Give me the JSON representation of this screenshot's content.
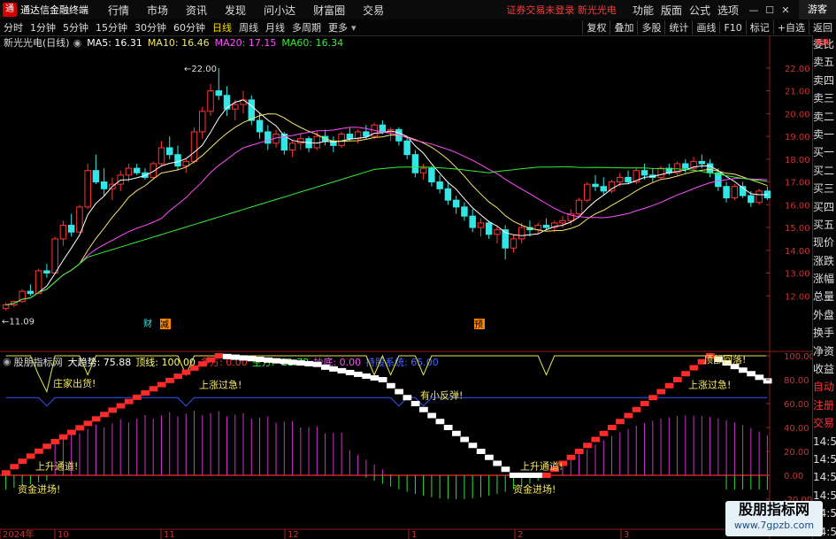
{
  "app": {
    "title": "通达信金融终端",
    "menus": [
      "行情",
      "市场",
      "资讯",
      "发现",
      "问小达",
      "财富圈",
      "交易"
    ],
    "warning": "证券交易未登录 新光光电",
    "right_menus": [
      "功能",
      "版面",
      "公式",
      "选项"
    ],
    "guest": "游客"
  },
  "periods": [
    {
      "label": "分时"
    },
    {
      "label": "1分钟"
    },
    {
      "label": "5分钟"
    },
    {
      "label": "15分钟"
    },
    {
      "label": "30分钟"
    },
    {
      "label": "60分钟"
    },
    {
      "label": "日线",
      "active": true
    },
    {
      "label": "周线"
    },
    {
      "label": "月线"
    },
    {
      "label": "多周期"
    },
    {
      "label": "更多"
    }
  ],
  "tools": [
    "复权",
    "叠加",
    "多股",
    "统计",
    "画线",
    "F10",
    "标记",
    "+自选",
    "返回"
  ],
  "stock": {
    "name": "新光光电(日线)",
    "ma": [
      {
        "label": "MA5: 16.31",
        "color": "#ffffff"
      },
      {
        "label": "MA10: 16.46",
        "color": "#f5e663"
      },
      {
        "label": "MA20: 17.15",
        "color": "#ff4dff"
      },
      {
        "label": "MA60: 16.34",
        "color": "#33ee33"
      }
    ]
  },
  "indicator": {
    "name": "股朋指标网",
    "values": [
      {
        "label": "大趋势: 75.88",
        "color": "#ffffff"
      },
      {
        "label": "顶线: 100.00",
        "color": "#ffff66"
      },
      {
        "label": "多方: 0.00",
        "color": "#ff3333"
      },
      {
        "label": "空方: -21.72",
        "color": "#33ff33"
      },
      {
        "label": "抄底: 0.00",
        "color": "#ff4dff"
      },
      {
        "label": "持股系统: 65.00",
        "color": "#4466ff"
      }
    ]
  },
  "price_axis": [
    "22.00",
    "21.00",
    "20.00",
    "19.00",
    "18.00",
    "17.00",
    "16.00",
    "15.00",
    "14.00",
    "13.00",
    "12.00"
  ],
  "ind_axis": [
    "100.00",
    "80.00",
    "60.00",
    "40.00",
    "20.00",
    "0.00",
    "-20.00"
  ],
  "date_axis": [
    "2024年",
    "10",
    "11",
    "12",
    "1",
    "2",
    "3"
  ],
  "annotations": {
    "high": "22.00",
    "low": "11.09",
    "cai": "财",
    "jian": "减",
    "yu": "预",
    "ind": [
      "庄家出货!",
      "上涨过急!",
      "有小反弹!",
      "上升通道!",
      "资金进场!",
      "上升通道!",
      "资金进场!",
      "上涨过急!",
      "顶部回落!"
    ]
  },
  "sidebar": [
    "委比",
    "卖五",
    "卖四",
    "卖三",
    "卖二",
    "卖一",
    "买一",
    "买二",
    "买三",
    "买四",
    "买五",
    "现价",
    "涨跌",
    "涨幅",
    "总量",
    "外盘",
    "换手",
    "净资",
    "收益",
    "自动",
    "注册",
    "交易",
    "14:54",
    "14:54",
    "14:54",
    "14:55",
    "14:55",
    "14:56",
    "14:56"
  ],
  "watermark": {
    "a": "股朋指标网",
    "b": "www.7gpzb.com"
  },
  "candles": [
    [
      11.45,
      11.7,
      11.35,
      11.6
    ],
    [
      11.6,
      11.8,
      11.5,
      11.75
    ],
    [
      11.75,
      12.3,
      11.7,
      12.2
    ],
    [
      12.2,
      12.5,
      12.0,
      12.1
    ],
    [
      12.1,
      13.2,
      12.1,
      13.1
    ],
    [
      13.1,
      13.4,
      12.8,
      13.0
    ],
    [
      13.0,
      14.6,
      13.0,
      14.5
    ],
    [
      14.5,
      15.3,
      14.2,
      15.1
    ],
    [
      15.1,
      15.6,
      14.6,
      14.8
    ],
    [
      14.8,
      16.0,
      14.8,
      15.9
    ],
    [
      15.9,
      17.8,
      15.8,
      17.5
    ],
    [
      17.5,
      18.2,
      16.9,
      17.0
    ],
    [
      17.0,
      17.6,
      16.4,
      16.7
    ],
    [
      16.7,
      17.2,
      16.2,
      16.9
    ],
    [
      16.9,
      17.5,
      16.6,
      17.3
    ],
    [
      17.3,
      17.8,
      17.0,
      17.6
    ],
    [
      17.6,
      17.8,
      17.3,
      17.4
    ],
    [
      17.4,
      17.6,
      17.1,
      17.2
    ],
    [
      17.2,
      17.9,
      17.1,
      17.8
    ],
    [
      17.8,
      18.8,
      17.7,
      18.5
    ],
    [
      18.5,
      19.0,
      18.0,
      18.2
    ],
    [
      18.2,
      18.6,
      17.5,
      17.7
    ],
    [
      17.7,
      18.0,
      17.4,
      17.9
    ],
    [
      17.9,
      19.4,
      17.8,
      19.2
    ],
    [
      19.2,
      20.3,
      18.9,
      20.1
    ],
    [
      20.1,
      21.3,
      19.9,
      21.0
    ],
    [
      21.0,
      22.0,
      20.6,
      20.8
    ],
    [
      20.8,
      21.2,
      19.9,
      20.2
    ],
    [
      20.2,
      20.6,
      19.7,
      20.4
    ],
    [
      20.4,
      21.0,
      20.0,
      20.6
    ],
    [
      20.6,
      20.8,
      19.5,
      19.7
    ],
    [
      19.7,
      20.0,
      18.9,
      19.2
    ],
    [
      19.2,
      19.5,
      18.4,
      18.7
    ],
    [
      18.7,
      19.3,
      18.5,
      19.1
    ],
    [
      19.1,
      19.2,
      18.2,
      18.4
    ],
    [
      18.4,
      18.8,
      18.1,
      18.7
    ],
    [
      18.7,
      19.1,
      18.4,
      18.9
    ],
    [
      18.9,
      19.0,
      18.3,
      18.5
    ],
    [
      18.5,
      19.2,
      18.4,
      19.0
    ],
    [
      19.0,
      19.3,
      18.6,
      18.8
    ],
    [
      18.8,
      19.0,
      18.3,
      18.6
    ],
    [
      18.6,
      19.2,
      18.5,
      19.1
    ],
    [
      19.1,
      19.4,
      18.8,
      18.9
    ],
    [
      18.9,
      19.3,
      18.7,
      19.2
    ],
    [
      19.2,
      19.5,
      18.9,
      19.0
    ],
    [
      19.0,
      19.6,
      18.9,
      19.5
    ],
    [
      19.5,
      19.7,
      19.1,
      19.2
    ],
    [
      19.2,
      19.4,
      18.8,
      19.3
    ],
    [
      19.3,
      19.4,
      18.6,
      18.8
    ],
    [
      18.8,
      19.0,
      18.0,
      18.2
    ],
    [
      18.2,
      18.4,
      17.2,
      17.4
    ],
    [
      17.4,
      17.8,
      17.1,
      17.6
    ],
    [
      17.6,
      17.7,
      16.8,
      17.0
    ],
    [
      17.0,
      17.3,
      16.5,
      16.7
    ],
    [
      16.7,
      17.0,
      16.0,
      16.2
    ],
    [
      16.2,
      16.4,
      15.6,
      15.9
    ],
    [
      15.9,
      16.1,
      15.3,
      15.5
    ],
    [
      15.5,
      15.8,
      14.8,
      15.0
    ],
    [
      15.0,
      15.4,
      14.6,
      15.2
    ],
    [
      15.2,
      15.3,
      14.5,
      14.7
    ],
    [
      14.7,
      15.1,
      14.3,
      14.9
    ],
    [
      14.9,
      15.1,
      13.6,
      14.1
    ],
    [
      14.1,
      14.7,
      13.9,
      14.5
    ],
    [
      14.5,
      15.2,
      14.3,
      15.0
    ],
    [
      15.0,
      15.3,
      14.6,
      14.9
    ],
    [
      14.9,
      15.2,
      14.7,
      15.1
    ],
    [
      15.1,
      15.4,
      14.9,
      15.0
    ],
    [
      15.0,
      15.3,
      14.8,
      15.2
    ],
    [
      15.2,
      15.5,
      15.0,
      15.3
    ],
    [
      15.3,
      15.8,
      15.1,
      15.6
    ],
    [
      15.6,
      16.3,
      15.5,
      16.2
    ],
    [
      16.2,
      17.0,
      16.1,
      16.9
    ],
    [
      16.9,
      17.3,
      16.6,
      16.8
    ],
    [
      16.8,
      17.2,
      16.4,
      16.6
    ],
    [
      16.6,
      17.1,
      16.5,
      17.0
    ],
    [
      17.0,
      17.4,
      16.8,
      17.2
    ],
    [
      17.2,
      17.5,
      16.9,
      17.0
    ],
    [
      17.0,
      17.6,
      16.9,
      17.5
    ],
    [
      17.5,
      17.8,
      17.1,
      17.3
    ],
    [
      17.3,
      17.6,
      17.0,
      17.2
    ],
    [
      17.2,
      17.7,
      17.1,
      17.6
    ],
    [
      17.6,
      17.8,
      17.3,
      17.4
    ],
    [
      17.4,
      17.9,
      17.3,
      17.8
    ],
    [
      17.8,
      18.0,
      17.4,
      17.6
    ],
    [
      17.6,
      18.1,
      17.5,
      17.9
    ],
    [
      17.9,
      18.2,
      17.6,
      17.8
    ],
    [
      17.8,
      18.0,
      17.2,
      17.4
    ],
    [
      17.4,
      17.6,
      16.6,
      16.8
    ],
    [
      16.8,
      17.0,
      16.1,
      16.3
    ],
    [
      16.3,
      16.9,
      16.2,
      16.8
    ],
    [
      16.8,
      17.0,
      16.3,
      16.4
    ],
    [
      16.4,
      16.6,
      15.9,
      16.1
    ],
    [
      16.1,
      16.7,
      16.0,
      16.6
    ],
    [
      16.6,
      16.8,
      16.2,
      16.3
    ]
  ]
}
